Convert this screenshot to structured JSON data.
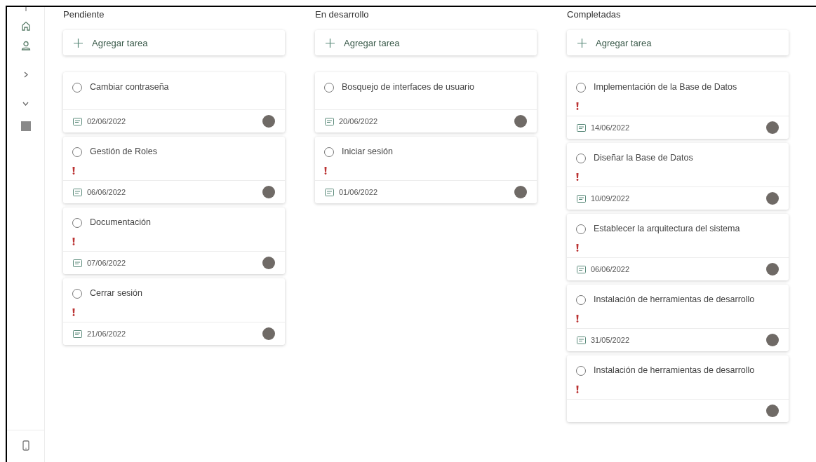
{
  "columns": [
    {
      "title": "Pendiente",
      "add_label": "Agregar tarea",
      "tasks": [
        {
          "title": "Cambiar contraseña",
          "important": false,
          "date": "02/06/2022"
        },
        {
          "title": "Gestión de Roles",
          "important": true,
          "date": "06/06/2022"
        },
        {
          "title": "Documentación",
          "important": true,
          "date": "07/06/2022"
        },
        {
          "title": "Cerrar sesión",
          "important": true,
          "date": "21/06/2022"
        }
      ]
    },
    {
      "title": "En desarrollo",
      "add_label": "Agregar tarea",
      "tasks": [
        {
          "title": "Bosquejo de interfaces de usuario",
          "important": false,
          "date": "20/06/2022"
        },
        {
          "title": "Iniciar sesión",
          "important": true,
          "date": "01/06/2022"
        }
      ]
    },
    {
      "title": "Completadas",
      "add_label": "Agregar tarea",
      "tasks": [
        {
          "title": "Implementación de la Base de Datos",
          "important": true,
          "date": "14/06/2022"
        },
        {
          "title": "Diseñar la Base de Datos",
          "important": true,
          "date": "10/09/2022"
        },
        {
          "title": "Establecer la arquitectura del sistema",
          "important": true,
          "date": "06/06/2022"
        },
        {
          "title": "Instalación de herramientas de desarrollo",
          "important": true,
          "date": "31/05/2022"
        },
        {
          "title": "Instalación de herramientas de desarrollo",
          "important": true
        }
      ]
    }
  ]
}
